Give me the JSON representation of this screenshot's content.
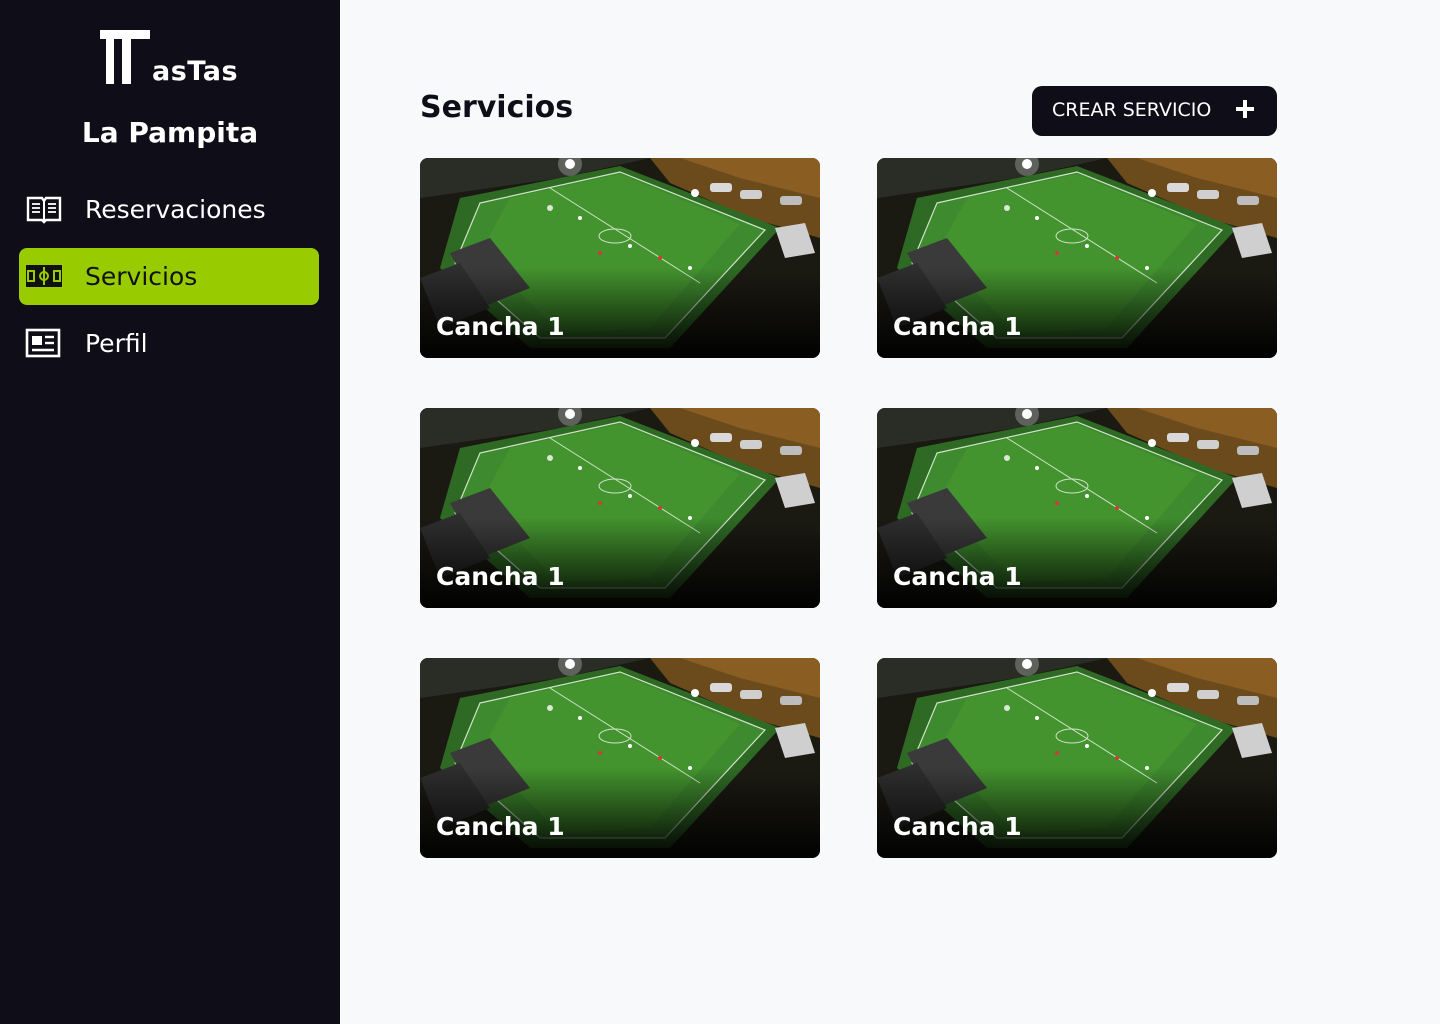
{
  "app": {
    "logo_text": "asTas",
    "venue_name": "La Pampita"
  },
  "sidebar": {
    "items": [
      {
        "label": "Reservaciones",
        "icon": "book-icon",
        "active": false
      },
      {
        "label": "Servicios",
        "icon": "soccer-field-icon",
        "active": true
      },
      {
        "label": "Perfil",
        "icon": "profile-card-icon",
        "active": false
      }
    ]
  },
  "main": {
    "title": "Servicios",
    "create_button_label": "CREAR SERVICIO",
    "services": [
      {
        "name": "Cancha 1"
      },
      {
        "name": "Cancha 1"
      },
      {
        "name": "Cancha 1"
      },
      {
        "name": "Cancha 1"
      },
      {
        "name": "Cancha 1"
      },
      {
        "name": "Cancha 1"
      }
    ]
  },
  "colors": {
    "sidebar_bg": "#0e0d18",
    "accent": "#99cc00",
    "page_bg": "#f8f9fb"
  }
}
